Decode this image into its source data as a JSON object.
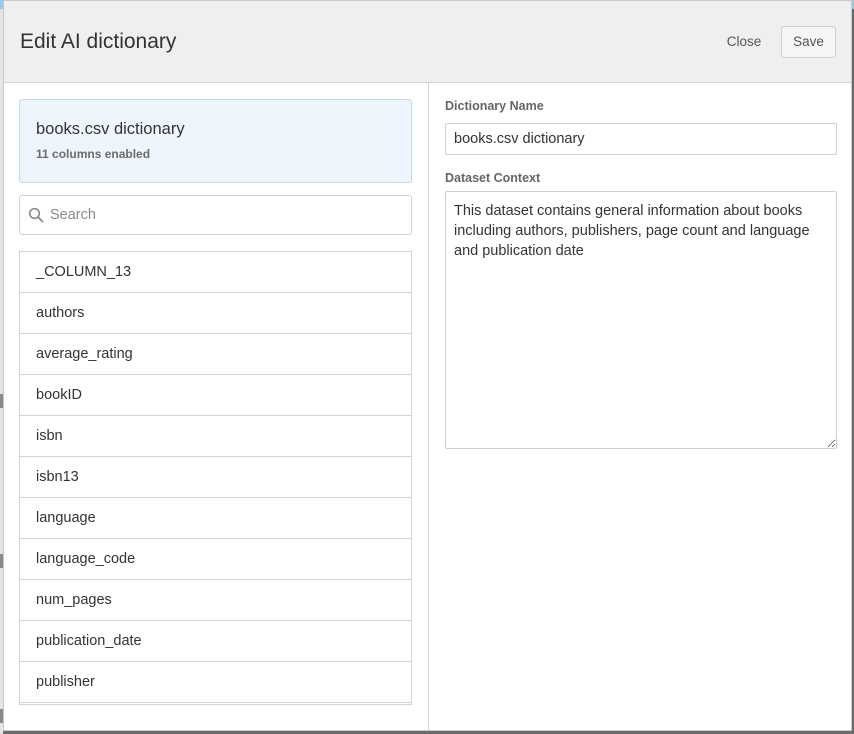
{
  "header": {
    "title": "Edit AI dictionary",
    "close_label": "Close",
    "save_label": "Save"
  },
  "dictionary_card": {
    "title": "books.csv dictionary",
    "subtitle": "11 columns enabled"
  },
  "search": {
    "placeholder": "Search",
    "value": ""
  },
  "columns": [
    "_COLUMN_13",
    "authors",
    "average_rating",
    "bookID",
    "isbn",
    "isbn13",
    "language",
    "language_code",
    "num_pages",
    "publication_date",
    "publisher"
  ],
  "form": {
    "name_label": "Dictionary Name",
    "name_value": "books.csv dictionary",
    "context_label": "Dataset Context",
    "context_value": "This dataset contains general information about books including authors, publishers, page count and language and publication date"
  },
  "colors": {
    "top_accent": "#9ccbe9",
    "card_bg": "#eef5fc",
    "header_bg": "#efefef"
  },
  "icons": {
    "search": "search-icon"
  }
}
